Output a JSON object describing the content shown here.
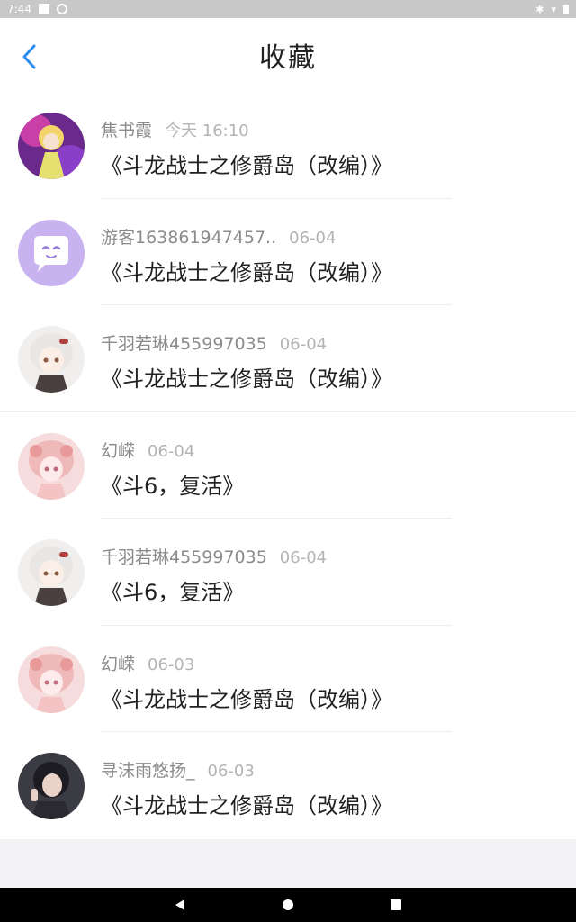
{
  "status_bar": {
    "time": "7:44"
  },
  "header": {
    "title": "收藏"
  },
  "colors": {
    "accent": "#2d8cf0",
    "divider": "#eeeeee"
  },
  "items": [
    {
      "user": "焦书霞",
      "time": "今天 16:10",
      "text": "《斗龙战士之修爵岛（改编）》",
      "avatar_icon": "anime-character-avatar"
    },
    {
      "user": "游客163861947457..",
      "time": "06-04",
      "text": "《斗龙战士之修爵岛（改编）》",
      "avatar_icon": "chat-bubble-avatar"
    },
    {
      "user": "千羽若琳455997035",
      "time": "06-04",
      "text": "《斗龙战士之修爵岛（改编）》",
      "avatar_icon": "white-hair-girl-avatar"
    },
    {
      "user": "幻嵘",
      "time": "06-04",
      "text": "《斗6，复活》",
      "avatar_icon": "pink-hair-girl-avatar"
    },
    {
      "user": "千羽若琳455997035",
      "time": "06-04",
      "text": "《斗6，复活》",
      "avatar_icon": "white-hair-girl-avatar"
    },
    {
      "user": "幻嵘",
      "time": "06-03",
      "text": "《斗龙战士之修爵岛（改编）》",
      "avatar_icon": "pink-hair-girl-avatar"
    },
    {
      "user": "寻沫雨悠扬_",
      "time": "06-03",
      "text": "《斗龙战士之修爵岛（改编）》",
      "avatar_icon": "photo-person-avatar"
    }
  ]
}
